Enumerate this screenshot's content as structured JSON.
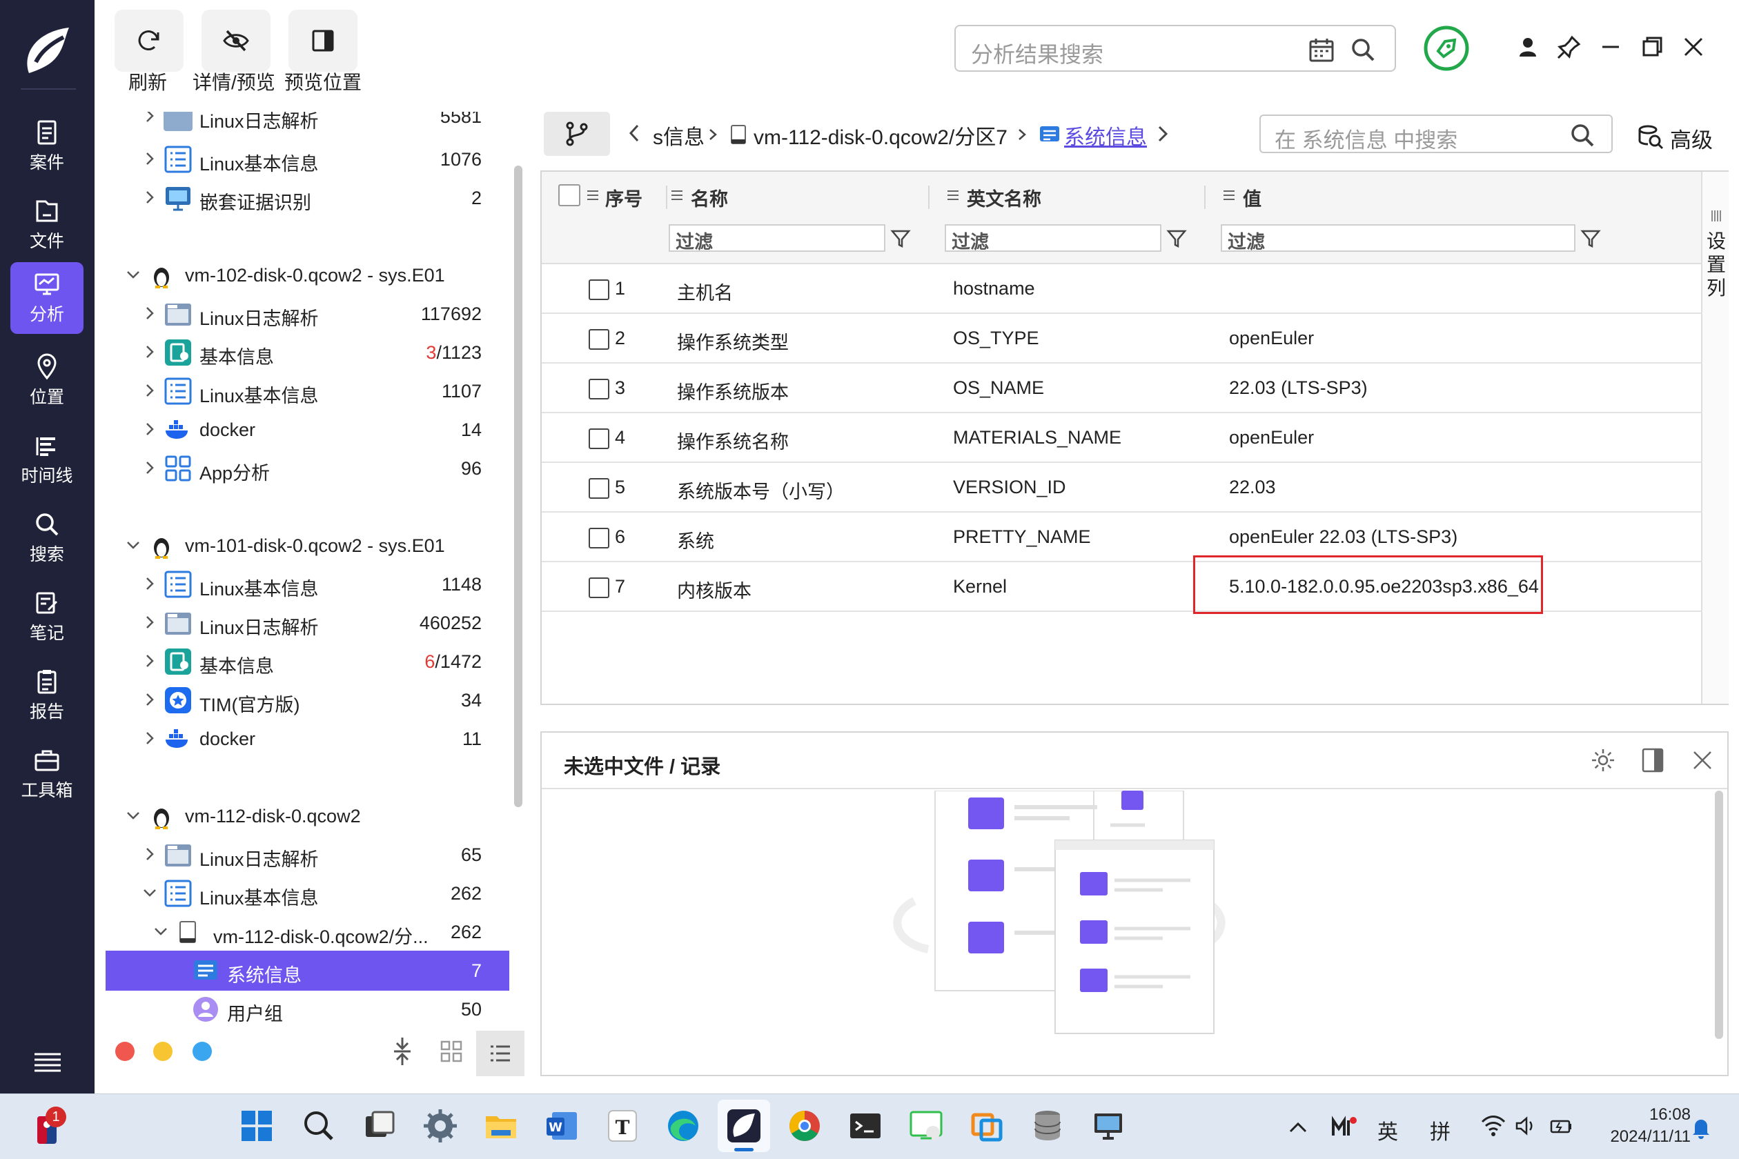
{
  "toolbar": {
    "refresh_label": "刷新",
    "detail_preview_label": "详情/预览",
    "preview_position_label": "预览位置"
  },
  "search": {
    "placeholder": "分析结果搜索"
  },
  "nav": {
    "items": [
      {
        "label": "案件",
        "icon": "case-icon"
      },
      {
        "label": "文件",
        "icon": "file-icon"
      },
      {
        "label": "分析",
        "icon": "analysis-icon"
      },
      {
        "label": "位置",
        "icon": "location-icon"
      },
      {
        "label": "时间线",
        "icon": "timeline-icon"
      },
      {
        "label": "搜索",
        "icon": "search-icon"
      },
      {
        "label": "笔记",
        "icon": "note-icon"
      },
      {
        "label": "报告",
        "icon": "report-icon"
      },
      {
        "label": "工具箱",
        "icon": "toolbox-icon"
      }
    ]
  },
  "tree": {
    "partial_top": {
      "label": "Linux日志解析",
      "count": "5581"
    },
    "rows": [
      {
        "label": "Linux基本信息",
        "count": "1076"
      },
      {
        "label": "嵌套证据识别",
        "count": "2"
      },
      {
        "label": "vm-102-disk-0.qcow2 - sys.E01",
        "count": ""
      },
      {
        "label": "Linux日志解析",
        "count": "117692"
      },
      {
        "label": "基本信息",
        "count_red": "3",
        "count": "/1123"
      },
      {
        "label": "Linux基本信息",
        "count": "1107"
      },
      {
        "label": "docker",
        "count": "14"
      },
      {
        "label": "App分析",
        "count": "96"
      },
      {
        "label": "vm-101-disk-0.qcow2 - sys.E01",
        "count": ""
      },
      {
        "label": "Linux基本信息",
        "count": "1148"
      },
      {
        "label": "Linux日志解析",
        "count": "460252"
      },
      {
        "label": "基本信息",
        "count_red": "6",
        "count": "/1472"
      },
      {
        "label": "TIM(官方版)",
        "count": "34"
      },
      {
        "label": "docker",
        "count": "11"
      },
      {
        "label": "vm-112-disk-0.qcow2",
        "count": ""
      },
      {
        "label": "Linux日志解析",
        "count": "65"
      },
      {
        "label": "Linux基本信息",
        "count": "262"
      },
      {
        "label": "vm-112-disk-0.qcow2/分...",
        "count": "262"
      },
      {
        "label": "系统信息",
        "count": "7"
      },
      {
        "label": "用户组",
        "count": "50"
      }
    ]
  },
  "breadcrumb": {
    "item1": "s信息",
    "item2": "vm-112-disk-0.qcow2/分区7",
    "item3": "系统信息",
    "search_placeholder": "在 系统信息 中搜索",
    "advanced_label": "高级"
  },
  "grid": {
    "columns": [
      "序号",
      "名称",
      "英文名称",
      "值"
    ],
    "filter_placeholder": "过滤",
    "settings_label": "设置列",
    "rows": [
      {
        "no": "1",
        "name": "主机名",
        "en": "hostname",
        "value": ""
      },
      {
        "no": "2",
        "name": "操作系统类型",
        "en": "OS_TYPE",
        "value": "openEuler"
      },
      {
        "no": "3",
        "name": "操作系统版本",
        "en": "OS_NAME",
        "value": "22.03 (LTS-SP3)"
      },
      {
        "no": "4",
        "name": "操作系统名称",
        "en": "MATERIALS_NAME",
        "value": "openEuler"
      },
      {
        "no": "5",
        "name": "系统版本号（小写）",
        "en": "VERSION_ID",
        "value": "22.03"
      },
      {
        "no": "6",
        "name": "系统",
        "en": "PRETTY_NAME",
        "value": "openEuler 22.03 (LTS-SP3)"
      },
      {
        "no": "7",
        "name": "内核版本",
        "en": "Kernel",
        "value": "5.10.0-182.0.0.95.oe2203sp3.x86_64"
      }
    ]
  },
  "detail": {
    "title": "未选中文件 / 记录"
  },
  "taskbar": {
    "badge": "1",
    "lang1": "英",
    "lang2": "拼",
    "time": "16:08",
    "date": "2024/11/11"
  },
  "colors": {
    "accent": "#6e55f0",
    "nav_bg": "#1f2238",
    "highlight": "#e0262a"
  }
}
